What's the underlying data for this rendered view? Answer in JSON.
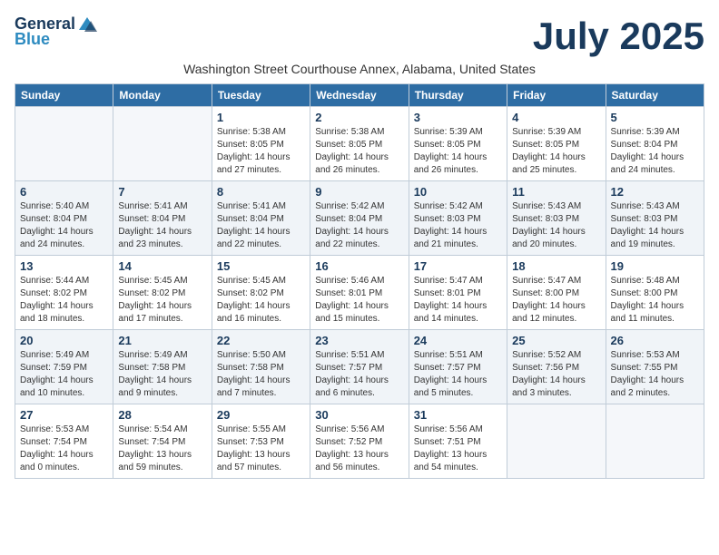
{
  "logo": {
    "general": "General",
    "blue": "Blue"
  },
  "month": "July 2025",
  "subtitle": "Washington Street Courthouse Annex, Alabama, United States",
  "days_header": [
    "Sunday",
    "Monday",
    "Tuesday",
    "Wednesday",
    "Thursday",
    "Friday",
    "Saturday"
  ],
  "weeks": [
    {
      "shaded": false,
      "days": [
        {
          "number": "",
          "info": ""
        },
        {
          "number": "",
          "info": ""
        },
        {
          "number": "1",
          "info": "Sunrise: 5:38 AM\nSunset: 8:05 PM\nDaylight: 14 hours and 27 minutes."
        },
        {
          "number": "2",
          "info": "Sunrise: 5:38 AM\nSunset: 8:05 PM\nDaylight: 14 hours and 26 minutes."
        },
        {
          "number": "3",
          "info": "Sunrise: 5:39 AM\nSunset: 8:05 PM\nDaylight: 14 hours and 26 minutes."
        },
        {
          "number": "4",
          "info": "Sunrise: 5:39 AM\nSunset: 8:05 PM\nDaylight: 14 hours and 25 minutes."
        },
        {
          "number": "5",
          "info": "Sunrise: 5:39 AM\nSunset: 8:04 PM\nDaylight: 14 hours and 24 minutes."
        }
      ]
    },
    {
      "shaded": true,
      "days": [
        {
          "number": "6",
          "info": "Sunrise: 5:40 AM\nSunset: 8:04 PM\nDaylight: 14 hours and 24 minutes."
        },
        {
          "number": "7",
          "info": "Sunrise: 5:41 AM\nSunset: 8:04 PM\nDaylight: 14 hours and 23 minutes."
        },
        {
          "number": "8",
          "info": "Sunrise: 5:41 AM\nSunset: 8:04 PM\nDaylight: 14 hours and 22 minutes."
        },
        {
          "number": "9",
          "info": "Sunrise: 5:42 AM\nSunset: 8:04 PM\nDaylight: 14 hours and 22 minutes."
        },
        {
          "number": "10",
          "info": "Sunrise: 5:42 AM\nSunset: 8:03 PM\nDaylight: 14 hours and 21 minutes."
        },
        {
          "number": "11",
          "info": "Sunrise: 5:43 AM\nSunset: 8:03 PM\nDaylight: 14 hours and 20 minutes."
        },
        {
          "number": "12",
          "info": "Sunrise: 5:43 AM\nSunset: 8:03 PM\nDaylight: 14 hours and 19 minutes."
        }
      ]
    },
    {
      "shaded": false,
      "days": [
        {
          "number": "13",
          "info": "Sunrise: 5:44 AM\nSunset: 8:02 PM\nDaylight: 14 hours and 18 minutes."
        },
        {
          "number": "14",
          "info": "Sunrise: 5:45 AM\nSunset: 8:02 PM\nDaylight: 14 hours and 17 minutes."
        },
        {
          "number": "15",
          "info": "Sunrise: 5:45 AM\nSunset: 8:02 PM\nDaylight: 14 hours and 16 minutes."
        },
        {
          "number": "16",
          "info": "Sunrise: 5:46 AM\nSunset: 8:01 PM\nDaylight: 14 hours and 15 minutes."
        },
        {
          "number": "17",
          "info": "Sunrise: 5:47 AM\nSunset: 8:01 PM\nDaylight: 14 hours and 14 minutes."
        },
        {
          "number": "18",
          "info": "Sunrise: 5:47 AM\nSunset: 8:00 PM\nDaylight: 14 hours and 12 minutes."
        },
        {
          "number": "19",
          "info": "Sunrise: 5:48 AM\nSunset: 8:00 PM\nDaylight: 14 hours and 11 minutes."
        }
      ]
    },
    {
      "shaded": true,
      "days": [
        {
          "number": "20",
          "info": "Sunrise: 5:49 AM\nSunset: 7:59 PM\nDaylight: 14 hours and 10 minutes."
        },
        {
          "number": "21",
          "info": "Sunrise: 5:49 AM\nSunset: 7:58 PM\nDaylight: 14 hours and 9 minutes."
        },
        {
          "number": "22",
          "info": "Sunrise: 5:50 AM\nSunset: 7:58 PM\nDaylight: 14 hours and 7 minutes."
        },
        {
          "number": "23",
          "info": "Sunrise: 5:51 AM\nSunset: 7:57 PM\nDaylight: 14 hours and 6 minutes."
        },
        {
          "number": "24",
          "info": "Sunrise: 5:51 AM\nSunset: 7:57 PM\nDaylight: 14 hours and 5 minutes."
        },
        {
          "number": "25",
          "info": "Sunrise: 5:52 AM\nSunset: 7:56 PM\nDaylight: 14 hours and 3 minutes."
        },
        {
          "number": "26",
          "info": "Sunrise: 5:53 AM\nSunset: 7:55 PM\nDaylight: 14 hours and 2 minutes."
        }
      ]
    },
    {
      "shaded": false,
      "days": [
        {
          "number": "27",
          "info": "Sunrise: 5:53 AM\nSunset: 7:54 PM\nDaylight: 14 hours and 0 minutes."
        },
        {
          "number": "28",
          "info": "Sunrise: 5:54 AM\nSunset: 7:54 PM\nDaylight: 13 hours and 59 minutes."
        },
        {
          "number": "29",
          "info": "Sunrise: 5:55 AM\nSunset: 7:53 PM\nDaylight: 13 hours and 57 minutes."
        },
        {
          "number": "30",
          "info": "Sunrise: 5:56 AM\nSunset: 7:52 PM\nDaylight: 13 hours and 56 minutes."
        },
        {
          "number": "31",
          "info": "Sunrise: 5:56 AM\nSunset: 7:51 PM\nDaylight: 13 hours and 54 minutes."
        },
        {
          "number": "",
          "info": ""
        },
        {
          "number": "",
          "info": ""
        }
      ]
    }
  ]
}
